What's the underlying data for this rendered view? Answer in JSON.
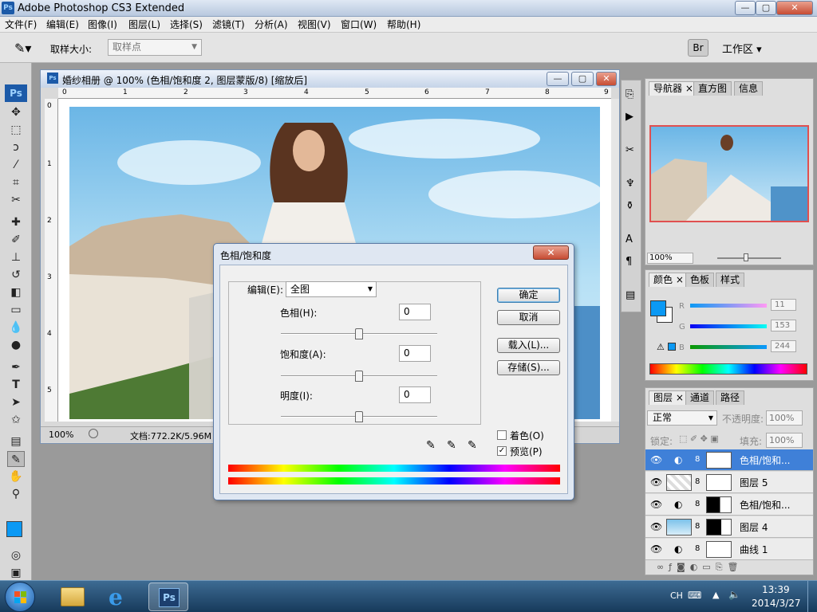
{
  "app": {
    "title": "Adobe Photoshop CS3 Extended",
    "icon_label": "Ps"
  },
  "window_buttons": {
    "minimize": "—",
    "maximize": "▢",
    "close": "✕"
  },
  "menu": [
    "文件(F)",
    "编辑(E)",
    "图像(I)",
    "图层(L)",
    "选择(S)",
    "滤镜(T)",
    "分析(A)",
    "视图(V)",
    "窗口(W)",
    "帮助(H)"
  ],
  "options": {
    "sample_size_label": "取样大小:",
    "sample_size_value": "取样点",
    "workspace_label": "工作区 ▾"
  },
  "document": {
    "title": "婚纱相册 @ 100% (色相/饱和度 2, 图层蒙版/8) [缩放后]",
    "ruler_h": [
      "0",
      "1",
      "2",
      "3",
      "4",
      "5",
      "6",
      "7",
      "8",
      "9"
    ],
    "ruler_v": [
      "0",
      "1",
      "2",
      "3",
      "4",
      "5"
    ],
    "zoom": "100%",
    "doc_info": "文档:772.2K/5.96M"
  },
  "dialog": {
    "title": "色相/饱和度",
    "edit_label": "编辑(E):",
    "edit_value": "全图",
    "hue_label": "色相(H):",
    "hue_value": "0",
    "hue_position": 0.5,
    "saturation_label": "饱和度(A):",
    "saturation_value": "0",
    "saturation_position": 0.5,
    "lightness_label": "明度(I):",
    "lightness_value": "0",
    "lightness_position": 0.5,
    "ok": "确定",
    "cancel": "取消",
    "load": "载入(L)...",
    "save": "存储(S)...",
    "colorize": "着色(O)",
    "colorize_checked": false,
    "preview": "预览(P)",
    "preview_checked": true
  },
  "navigator": {
    "tabs": [
      "导航器",
      "直方图",
      "信息"
    ],
    "zoom": "100%"
  },
  "color_panel": {
    "tabs": [
      "颜色",
      "色板",
      "样式"
    ],
    "r_label": "R",
    "r_value": "11",
    "g_label": "G",
    "g_value": "153",
    "b_label": "B",
    "b_value": "244",
    "foreground": "#0b99f4"
  },
  "layers_panel": {
    "tabs": [
      "图层",
      "通道",
      "路径"
    ],
    "blend_mode": "正常",
    "opacity_label": "不透明度:",
    "opacity_value": "100%",
    "lock_label": "锁定:",
    "fill_label": "填充:",
    "fill_value": "100%",
    "layers": [
      {
        "name": "色相/饱和...",
        "selected": true
      },
      {
        "name": "图层 5",
        "selected": false
      },
      {
        "name": "色相/饱和...",
        "selected": false
      },
      {
        "name": "图层 4",
        "selected": false
      },
      {
        "name": "曲线 1",
        "selected": false
      }
    ]
  },
  "taskbar": {
    "lang": "CH",
    "time": "13:39",
    "date": "2014/3/27",
    "ps_label": "Ps"
  }
}
